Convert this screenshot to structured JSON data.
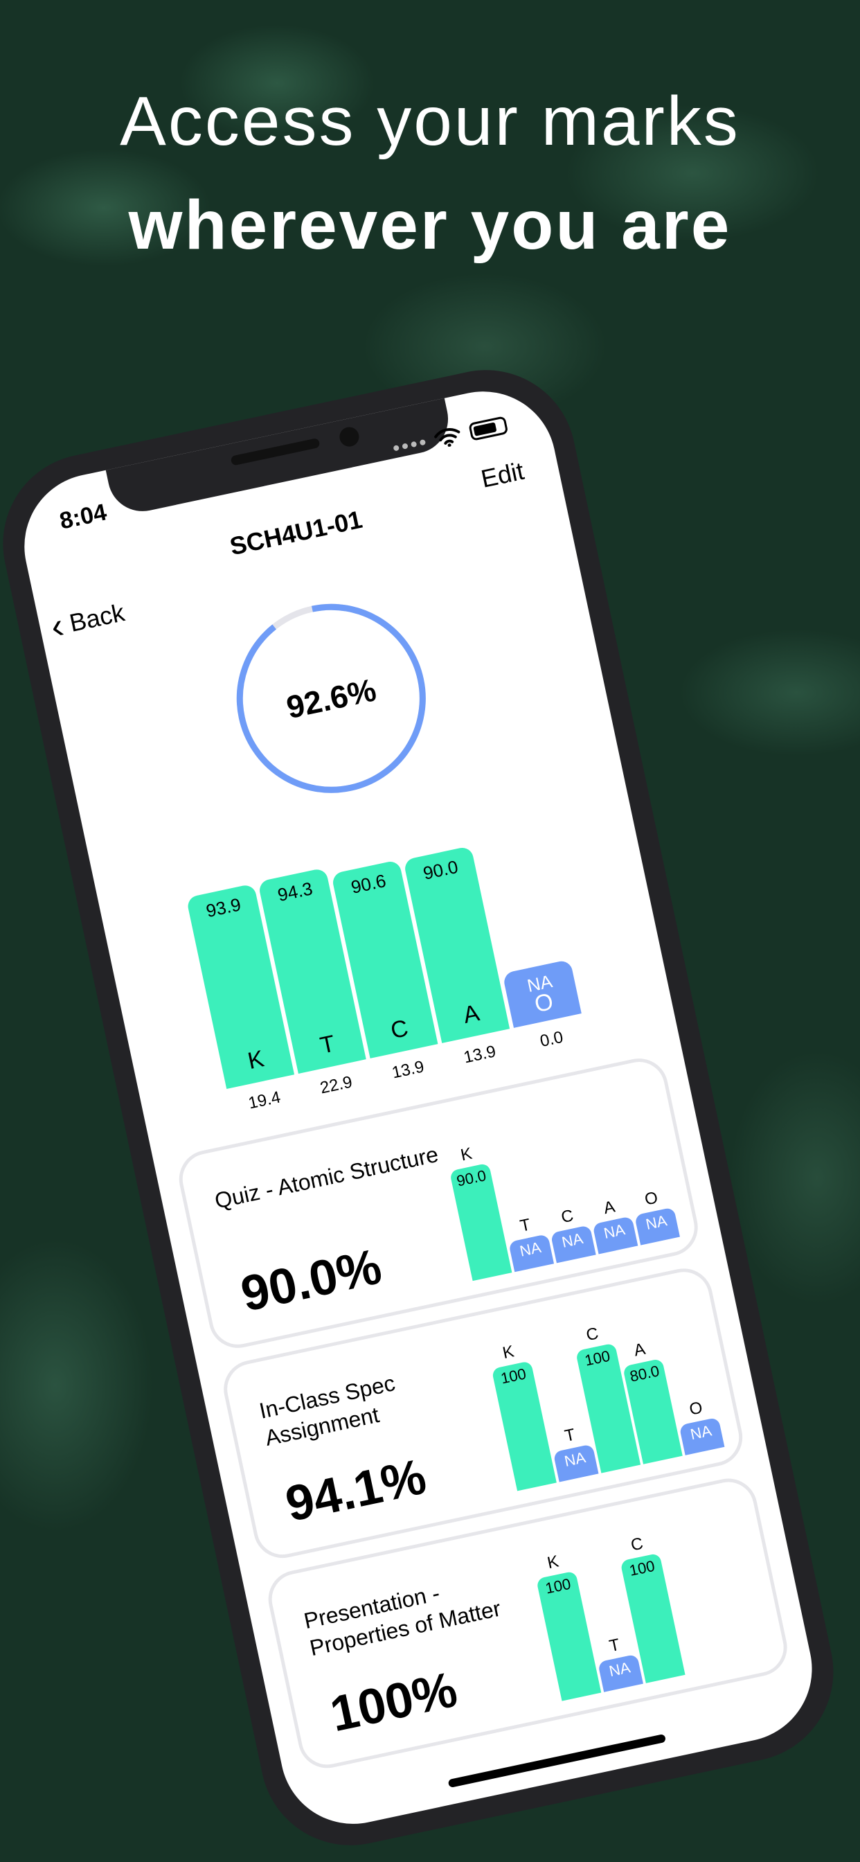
{
  "headline": {
    "line1": "Access your marks",
    "line2": "wherever you are"
  },
  "status": {
    "time": "8:04"
  },
  "nav": {
    "title": "SCH4U1-01",
    "back": "Back",
    "edit": "Edit"
  },
  "overall": {
    "percent_label": "92.6%",
    "percent": 92.6
  },
  "colors": {
    "bar": "#3cefbb",
    "na": "#6f9cf7",
    "ring": "#6f9cf7",
    "ring_track": "#e4e4ea"
  },
  "chart_data": {
    "type": "bar",
    "categories": [
      "K",
      "T",
      "C",
      "A",
      "O"
    ],
    "values": [
      93.9,
      94.3,
      90.6,
      90.0,
      null
    ],
    "value_labels": [
      "93.9",
      "94.3",
      "90.6",
      "90.0",
      "NA"
    ],
    "weights": [
      "19.4",
      "22.9",
      "13.9",
      "13.9",
      "0.0"
    ]
  },
  "cards": [
    {
      "title": "Quiz - Atomic Structure",
      "score": "90.0%",
      "bars": [
        {
          "cat": "K",
          "label": "90.0",
          "value": 90
        },
        {
          "cat": "T",
          "label": "NA",
          "value": null
        },
        {
          "cat": "C",
          "label": "NA",
          "value": null
        },
        {
          "cat": "A",
          "label": "NA",
          "value": null
        },
        {
          "cat": "O",
          "label": "NA",
          "value": null
        }
      ]
    },
    {
      "title": "In-Class Spec Assignment",
      "score": "94.1%",
      "bars": [
        {
          "cat": "K",
          "label": "100",
          "value": 100
        },
        {
          "cat": "T",
          "label": "NA",
          "value": null
        },
        {
          "cat": "C",
          "label": "100",
          "value": 100
        },
        {
          "cat": "A",
          "label": "80.0",
          "value": 80
        },
        {
          "cat": "O",
          "label": "NA",
          "value": null
        }
      ]
    },
    {
      "title": "Presentation - Properties of Matter",
      "score": "100%",
      "bars": [
        {
          "cat": "K",
          "label": "100",
          "value": 100
        },
        {
          "cat": "T",
          "label": "NA",
          "value": null
        },
        {
          "cat": "C",
          "label": "100",
          "value": 100
        }
      ]
    }
  ]
}
